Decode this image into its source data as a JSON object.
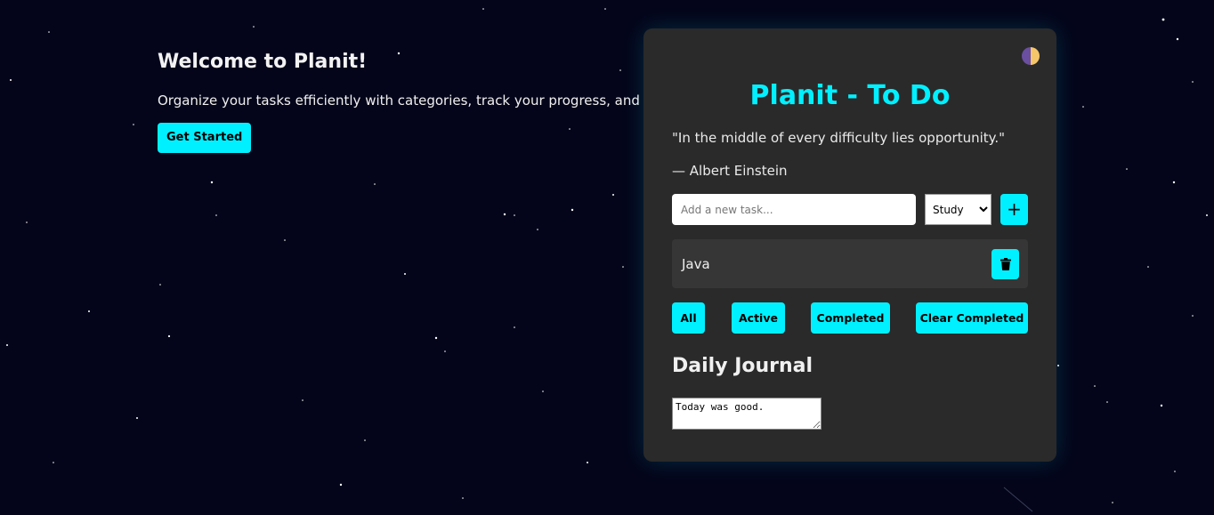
{
  "hero": {
    "title": "Welcome to Planit!",
    "description": "Organize your tasks efficiently with categories, track your progress, and more.",
    "cta_label": "Get Started"
  },
  "card": {
    "title": "Planit - To Do",
    "quote": "\"In the middle of every difficulty lies opportunity.\"",
    "author": "— Albert Einstein",
    "task_input": {
      "placeholder": "Add a new task...",
      "value": ""
    },
    "category_select": {
      "selected": "Study"
    },
    "add_label": "+",
    "tasks": [
      {
        "text": "Java"
      }
    ],
    "filters": {
      "all": "All",
      "active": "Active",
      "completed": "Completed",
      "clear_completed": "Clear Completed"
    },
    "journal": {
      "title": "Daily Journal",
      "value": "Today was good."
    }
  },
  "colors": {
    "background": "#04051a",
    "card": "#2a2a2a",
    "accent": "#00f0ff",
    "task_item": "#363636"
  },
  "icons": {
    "theme_toggle": "moon-sun-icon",
    "delete": "trash-icon"
  }
}
